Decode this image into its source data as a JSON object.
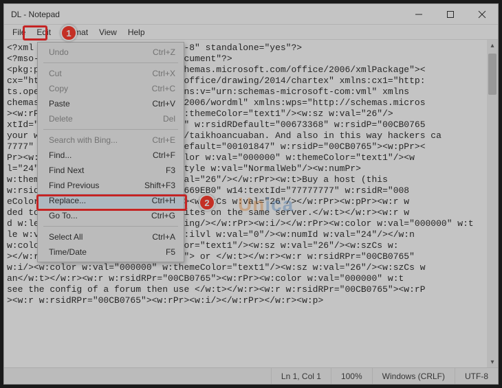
{
  "window": {
    "title": "DL - Notepad"
  },
  "menu": {
    "file": "File",
    "edit": "Edit",
    "format": "Format",
    "view": "View",
    "help": "Help"
  },
  "edit_menu": {
    "items": [
      {
        "label": "Undo",
        "accel": "Ctrl+Z",
        "disabled": true
      },
      {
        "sep": true
      },
      {
        "label": "Cut",
        "accel": "Ctrl+X",
        "disabled": true
      },
      {
        "label": "Copy",
        "accel": "Ctrl+C",
        "disabled": true
      },
      {
        "label": "Paste",
        "accel": "Ctrl+V",
        "disabled": false
      },
      {
        "label": "Delete",
        "accel": "Del",
        "disabled": true
      },
      {
        "sep": true
      },
      {
        "label": "Search with Bing...",
        "accel": "Ctrl+E",
        "disabled": true
      },
      {
        "label": "Find...",
        "accel": "Ctrl+F",
        "disabled": false
      },
      {
        "label": "Find Next",
        "accel": "F3",
        "disabled": false
      },
      {
        "label": "Find Previous",
        "accel": "Shift+F3",
        "disabled": false
      },
      {
        "label": "Replace...",
        "accel": "Ctrl+H",
        "disabled": false,
        "highlight": true
      },
      {
        "label": "Go To...",
        "accel": "Ctrl+G",
        "disabled": false
      },
      {
        "sep": true
      },
      {
        "label": "Select All",
        "accel": "Ctrl+A",
        "disabled": false
      },
      {
        "label": "Time/Date",
        "accel": "F5",
        "disabled": false
      }
    ]
  },
  "badges": {
    "1": "1",
    "2": "2"
  },
  "watermark": {
    "a": "Un",
    "b": "ica"
  },
  "editor": {
    "lines": [
      "<?xml version=\"1.0\" encoding=\"UTF-8\" standalone=\"yes\"?>",
      "<?mso-application progid=\"Word.Document\"?>",
      "<pkg:package xmlns:pkg=\"http://schemas.microsoft.com/office/2006/xmlPackage\"><",
      "cx=\"http://schemas.microsoft.com/office/drawing/2014/chartex\" xmlns:cx1=\"http:",
      "ts.openxmlformats.org/markup\" xmlns:v=\"urn:schemas-microsoft-com:vml\" xmlns",
      "chemas.microsoft.com/office/word/2006/wordml\" xmlns:wps=\"http://schemas.micros",
      "><w:rPr><w:color w:val=\"000000\" w:themeColor=\"text1\"/><w:sz w:val=\"26\"/>",
      "xtId=\"77777777\" w:rsidR=\"000A7D6F\" w:rsidRDefault=\"00673368\" w:rsidP=\"00CB0765",
      "your website by this way: https://taikhoancuaban. And also in this way hackers ca",
      "7777\" w:rsidR=\"00CB0765\" w:rsidRDefault=\"00101847\" w:rsidP=\"00CB0765\"><w:pPr><",
      "Pr><w:color w:val=\"000000\"/><w:color w:val=\"000000\" w:themeColor=\"text1\"/><w",
      "l=\"24\"/></w:numPr><w:pSty‎le><w:pStyle w:val=\"NormalWeb\"/><w:numPr>",
      "w:themeColor=\"text1\"/><w:szCs w:val=\"26\"/></w:rPr><w:t>Buy a host (this ",
      "w:rsidR=\"00CB0765\" w14:paraId=\"64669EB0\" w14:textId=\"77777777\" w:rsidR=\"008",
      "eColor=\"text1\"/><w:sz w:val=\"26\"/><w:szCs w:val=\"26\"/></w:rPr><w:pPr><w:r w",
      "ded to  bu‎y a host, add some websites on the same server.</w:t></w:r><w:r w",
      "d w:le​ft=\"720\"/><w:contextualSpacing/></w:rPr><w:i/></w:rPr><w:color w:val=\"000000\" w:t",
      "le w:val=\"NormalWeb\"/><w:numPr><w:ilvl w:val=\"0\"/><w:numId w:val=\"24\"/></w:n",
      "w:color w:val=\"000000\" w:themeColor=\"text1\"/><w:sz w:val=\"26\"/><w:szCs w:",
      "></w:rPr><w:t xml:space=\"preserve\"> or </w:t></w:r><w:r w:rsidRPr=\"00CB0765\"",
      "w:i/><w:color w:val=\"000000\" w:themeColor=\"text1\"/><w:sz w:val=\"26\"/><w:szCs w",
      "an</w:t></w:r><w:r w:rsidRPr=\"00CB0765\"><w:rPr><w:color w:val=\"000000\" w:t",
      "see the config of a forum then use </w:t></w:r><w:r w:rsidRPr=\"00CB0765\"><w:rP",
      "><w:r w:rsidRPr=\"00CB0765\"><w:rPr><w:i/></w:rPr></w:r><w:p>"
    ]
  },
  "status": {
    "pos": "Ln 1, Col 1",
    "zoom": "100%",
    "eol": "Windows (CRLF)",
    "enc": "UTF-8"
  }
}
